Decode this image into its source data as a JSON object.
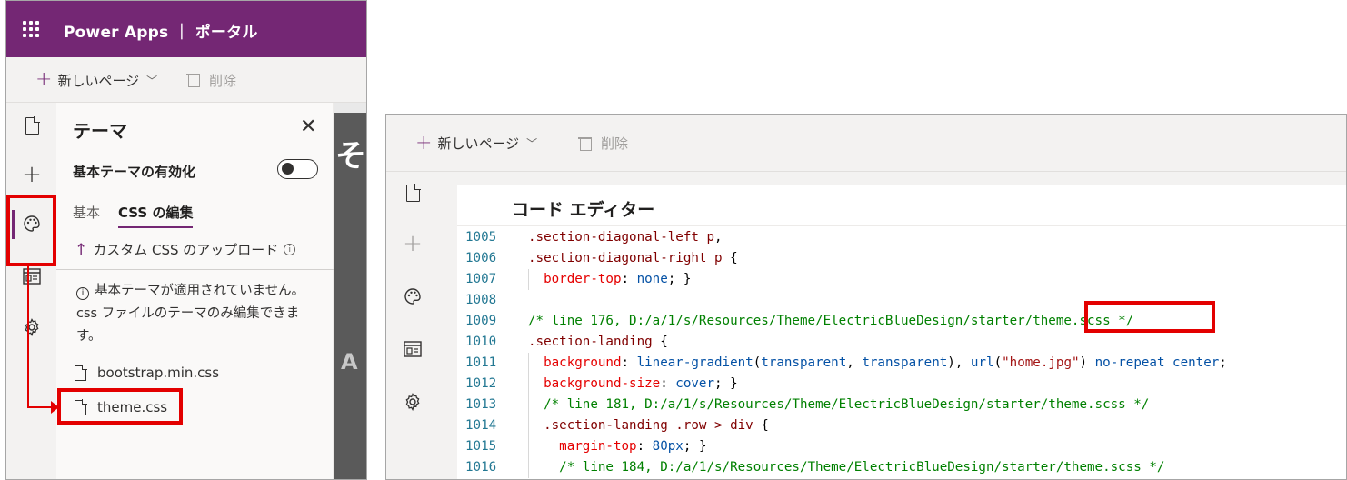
{
  "left_panel": {
    "app_title": "Power Apps ｜ ポータル",
    "commands": {
      "new_page": "新しいページ",
      "delete": "削除"
    },
    "theme_panel": {
      "title": "テーマ",
      "toggle_label": "基本テーマの有効化",
      "tabs": [
        "基本",
        "CSS の編集"
      ],
      "upload_label": "カスタム CSS のアップロード",
      "notice": "基本テーマが適用されていません。css ファイルのテーマのみ編集できます。",
      "files": [
        "bootstrap.min.css",
        "theme.css"
      ]
    },
    "preview_glyphs": [
      "そ",
      "A"
    ]
  },
  "right_panel": {
    "commands": {
      "new_page": "新しいページ",
      "delete": "削除"
    },
    "editor_title": "コード エディター",
    "code_lines": [
      {
        "n": "1005",
        "t": ".section-diagonal-left p,"
      },
      {
        "n": "1006",
        "t": ".section-diagonal-right p {"
      },
      {
        "n": "1007",
        "t": "  border-top: none; }"
      },
      {
        "n": "1008",
        "t": ""
      },
      {
        "n": "1009",
        "t": "/* line 176, D:/a/1/s/Resources/Theme/ElectricBlueDesign/starter/theme.scss */"
      },
      {
        "n": "1010",
        "t": ".section-landing {"
      },
      {
        "n": "1011",
        "t": "  background: linear-gradient(transparent, transparent), url(\"home.jpg\") no-repeat center;"
      },
      {
        "n": "1012",
        "t": "  background-size: cover; }"
      },
      {
        "n": "1013",
        "t": "  /* line 181, D:/a/1/s/Resources/Theme/ElectricBlueDesign/starter/theme.scss */"
      },
      {
        "n": "1014",
        "t": "  .section-landing .row > div {"
      },
      {
        "n": "1015",
        "t": "    margin-top: 80px; }"
      },
      {
        "n": "1016",
        "t": "    /* line 184, D:/a/1/s/Resources/Theme/ElectricBlueDesign/starter/theme.scss */"
      }
    ]
  },
  "colors": {
    "brand": "#742774",
    "highlight": "#e30000"
  }
}
